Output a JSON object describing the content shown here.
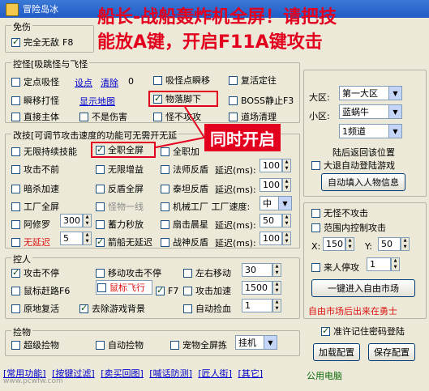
{
  "window": {
    "title": "冒险岛冰"
  },
  "sections": {
    "invincible": "免伤",
    "pick": "控怪[吸跳怪与飞怪",
    "mod": "改技[可调节攻击速度的功能可无需开无延",
    "controls": "控人",
    "pickup": "捡物"
  },
  "row_invincible": {
    "full_invincible": "完全无敌",
    "key": "F8"
  },
  "pick": {
    "fixed_suck": "定点吸怪",
    "set_point": "设点",
    "clear": "清除",
    "zero": "0",
    "suck_move": "吸怪点瞬移",
    "rot_fix": "复活定往",
    "teleport": "瞬移打怪",
    "show_map": "显示地图",
    "drop_feet": "物落脚下",
    "boss_stop": "BOSS静止F3",
    "direct_main": "直接主体",
    "no_hurt": "不是伤害",
    "monster_no_attack": "怪不攻攻",
    "field_cleanup": "道场清理"
  },
  "mod": {
    "r1": [
      "无限持续技能",
      "全职全屏",
      "全职加"
    ],
    "r2": [
      "攻击不前",
      "无限增益",
      "法师反盾",
      "延迟(ms):"
    ],
    "r3": [
      "暗杀加速",
      "反盾全屏",
      "泰坦反盾",
      "延迟(ms):"
    ],
    "r4": [
      "工厂全屏",
      "怪物一线",
      "机械工厂 工厂速度:"
    ],
    "r5": [
      "阿修罗",
      "蓄力秒放",
      "扇击晨星",
      "延迟(ms):"
    ],
    "r6": [
      "无延迟",
      "箭船无延迟",
      "战神反盾",
      "延迟(ms):"
    ],
    "v_fashi": "100",
    "v_taitan": "100",
    "speed": "中",
    "v_asura": "300",
    "v_shanji": "50",
    "v_nodelay": "5",
    "v_zhanshen": "100"
  },
  "controls": {
    "attack_nonstop": "攻击不停",
    "move_attack": "移动攻击不停",
    "lr_move": "左右移动",
    "lr_val": "30",
    "mouse_lure": "鼠标赶路F6",
    "mouse_fly": "鼠标飞行",
    "f7": "F7",
    "attack_speed": "攻击加速",
    "as_val": "1500",
    "revive": "原地复活",
    "remove_bg": "去除游戏背景",
    "auto_pick": "自动捡血",
    "ap_val": "1"
  },
  "pickup": {
    "super": "超级捡物",
    "auto": "自动捡物",
    "pet": "宠物全屏拣",
    "mode": "挂机"
  },
  "right": {
    "region_label": "大区:",
    "region": "第一大区",
    "sub_label": "小区:",
    "sub": "蓝蜗牛",
    "channel": "1频道",
    "landing": "陆后返回该位置",
    "auto_login": "大退自动登陆游戏",
    "fill_info": "自动填入人物信息",
    "no_attack": "无怪不攻击",
    "range_attack": "范围内控制攻击",
    "x_label": "X:",
    "x": "150",
    "y_label": "Y:",
    "y": "50",
    "stop_on_player": "来人停攻",
    "stop_val": "1",
    "enter_market": "一键进入自由市场",
    "market_note": "自由市场后出来在勇士",
    "remember_pw": "准许记住密码登陆",
    "load_config": "加载配置",
    "save_config": "保存配置"
  },
  "bottom_tabs": [
    "[常用功能]",
    "[按键过滤]",
    "[卖买回图]",
    "[喊话防测]",
    "[匠人街]",
    "[其它]"
  ],
  "status": "公用电脑",
  "overlay": {
    "headline1": "船长-战船轰炸机全屏！请把技",
    "headline2": "能放A键，开启F11A键攻击",
    "callout": "同时开启",
    "watermark": "www.pcwfw.com"
  },
  "colors": {
    "accent": "#e3001f",
    "titlebar": "#215bc7",
    "link": "#0000cc"
  }
}
